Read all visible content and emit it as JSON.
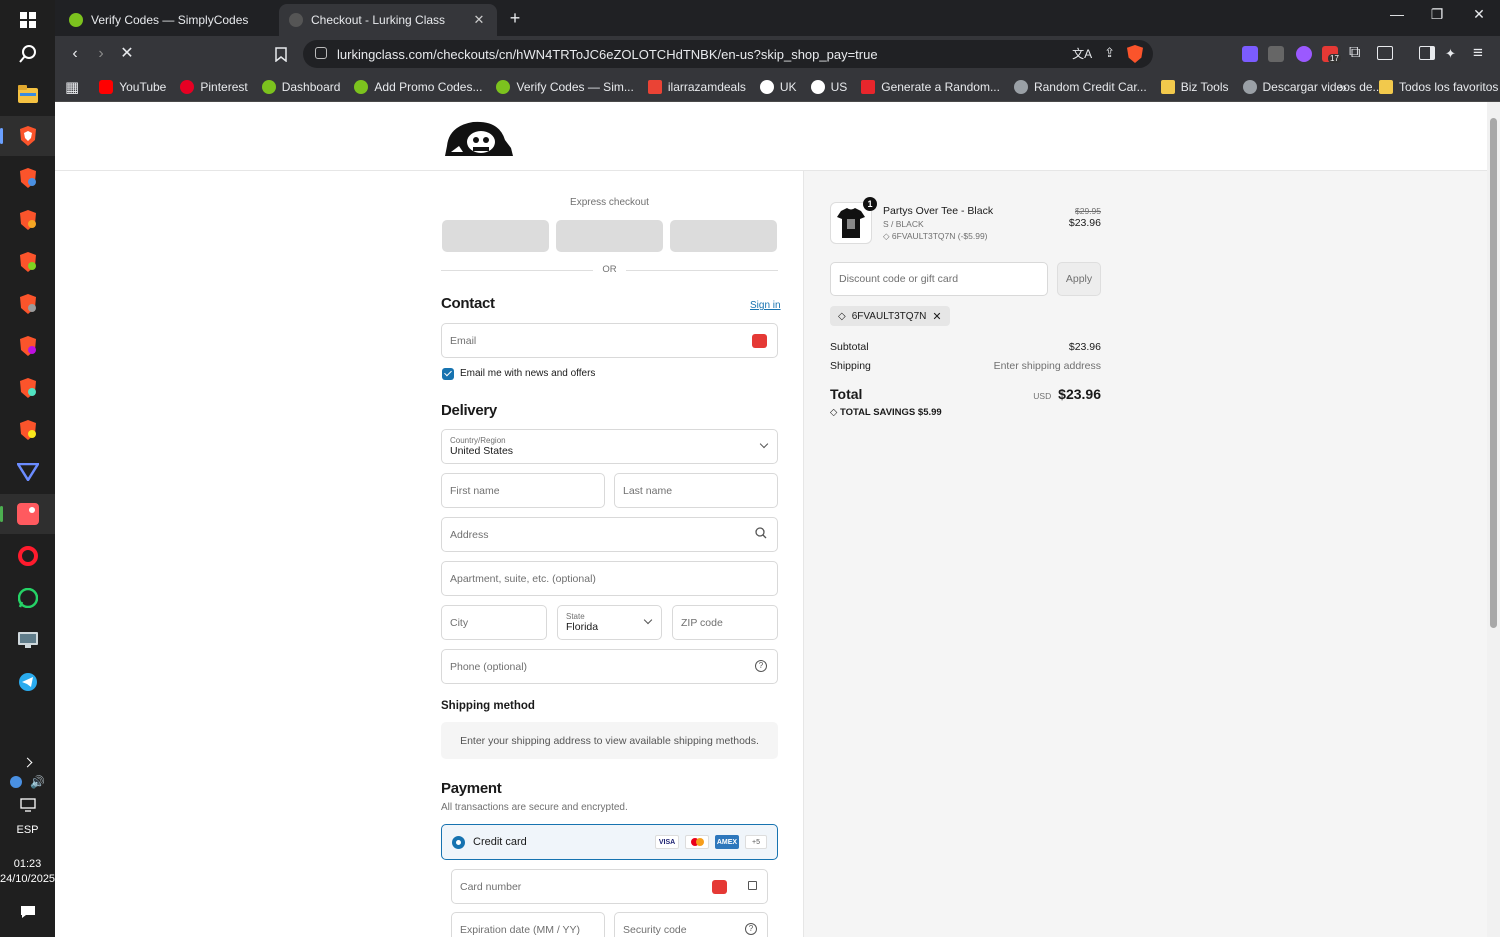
{
  "taskbar": {
    "language": "ESP",
    "time": "01:23",
    "date": "24/10/2025"
  },
  "tabs": [
    {
      "title": "Verify Codes — SimplyCodes"
    },
    {
      "title": "Checkout - Lurking Class"
    }
  ],
  "address_bar": {
    "url": "lurkingclass.com/checkouts/cn/hWN4TRToJC6eZOLOTCHdTNBK/en-us?skip_shop_pay=true"
  },
  "extensions": {
    "badge_count": "17"
  },
  "bookmarks": [
    {
      "label": "YouTube",
      "color": "#ff0000"
    },
    {
      "label": "Pinterest",
      "color": "#e60023"
    },
    {
      "label": "Dashboard",
      "color": "#7cc21e"
    },
    {
      "label": "Add Promo Codes...",
      "color": "#7cc21e"
    },
    {
      "label": "Verify Codes — Sim...",
      "color": "#7cc21e"
    },
    {
      "label": "ilarrazamdeals",
      "color": "#ea4335"
    },
    {
      "label": "UK",
      "color": "#ffffff"
    },
    {
      "label": "US",
      "color": "#ffffff"
    },
    {
      "label": "Generate a Random...",
      "color": "#e8262c"
    },
    {
      "label": "Random Credit Car...",
      "color": "#9aa0a6"
    },
    {
      "label": "Biz Tools",
      "color": "#f2c94c"
    },
    {
      "label": "Descargar videos de...",
      "color": "#9aa0a6"
    }
  ],
  "bookmarks_more": "»",
  "bookmarks_all": "Todos los favoritos",
  "checkout": {
    "express_label": "Express checkout",
    "or_label": "OR",
    "contact_title": "Contact",
    "sign_in": "Sign in",
    "email_placeholder": "Email",
    "newsletter_label": "Email me with news and offers",
    "delivery_title": "Delivery",
    "country_label": "Country/Region",
    "country_value": "United States",
    "first_name": "First name",
    "last_name": "Last name",
    "address": "Address",
    "apartment": "Apartment, suite, etc. (optional)",
    "city": "City",
    "state_label": "State",
    "state_value": "Florida",
    "zip": "ZIP code",
    "phone": "Phone (optional)",
    "shipping_method_title": "Shipping method",
    "shipping_method_note": "Enter your shipping address to view available shipping methods.",
    "payment_title": "Payment",
    "payment_note": "All transactions are secure and encrypted.",
    "credit_card_label": "Credit card",
    "card_more": "+5",
    "card_number": "Card number",
    "expiration": "Expiration date (MM / YY)",
    "security_code": "Security code"
  },
  "summary": {
    "item_qty": "1",
    "item_name": "Partys Over Tee - Black",
    "item_variant": "S / BLACK",
    "item_discount": "6FVAULT3TQ7N (-$5.99)",
    "item_original_price": "$29.95",
    "item_price": "$23.96",
    "discount_placeholder": "Discount code or gift card",
    "apply": "Apply",
    "applied_code": "6FVAULT3TQ7N",
    "subtotal_label": "Subtotal",
    "subtotal_value": "$23.96",
    "shipping_label": "Shipping",
    "shipping_value": "Enter shipping address",
    "total_label": "Total",
    "currency": "USD",
    "total_value": "$23.96",
    "savings_label": "TOTAL SAVINGS",
    "savings_value": "$5.99"
  },
  "colors": {
    "link": "#1773b0",
    "checkbox": "#1773b0"
  }
}
